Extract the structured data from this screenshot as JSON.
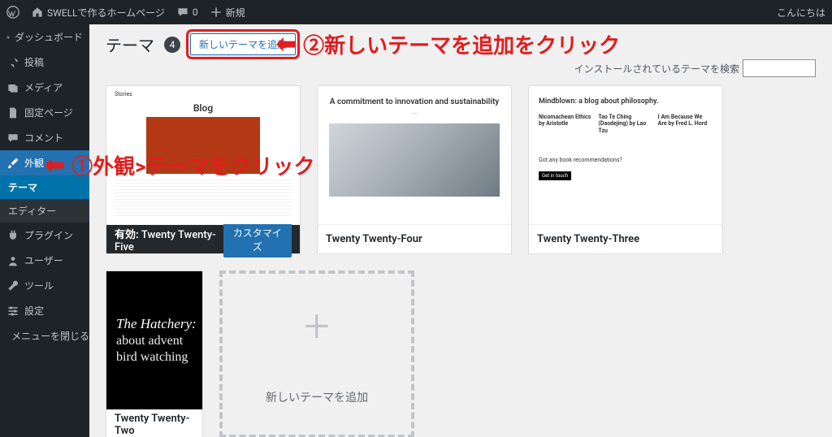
{
  "adminbar": {
    "site_name": "SWELLで作るホームページ",
    "comments": "0",
    "new": "新規",
    "greeting": "こんにちは"
  },
  "sidebar": {
    "dashboard": "ダッシュボード",
    "posts": "投稿",
    "media": "メディア",
    "pages": "固定ページ",
    "comments": "コメント",
    "appearance": "外観",
    "appearance_sub": {
      "themes": "テーマ",
      "editor": "エディター"
    },
    "plugins": "プラグイン",
    "users": "ユーザー",
    "tools": "ツール",
    "settings": "設定",
    "collapse": "メニューを閉じる"
  },
  "page": {
    "title": "テーマ",
    "count": "4",
    "add_new": "新しいテーマを追加",
    "search_label": "インストールされているテーマを検索",
    "active_prefix": "有効:"
  },
  "themes": [
    {
      "name": "Twenty Twenty-Five",
      "active": true,
      "customize": "カスタマイズ",
      "mock": {
        "blog_label": "Blog",
        "stories": "Stories"
      }
    },
    {
      "name": "Twenty Twenty-Four",
      "mock": {
        "head": "A commitment to innovation and sustainability"
      }
    },
    {
      "name": "Twenty Twenty-Three",
      "mock": {
        "tagline": "Mindblown: a blog about philosophy.",
        "col1_title": "Nicomachean Ethics by Aristotle",
        "col2_title": "Tao Te Ching (Daodejing) by Lao Tzu",
        "col3_title": "I Am Because We Are by Fred L. Hord",
        "cta_q": "Got any book recommendations?",
        "cta_btn": "Get in touch"
      }
    },
    {
      "name": "Twenty Twenty-Two",
      "mock": {
        "line1": "The Hatchery:",
        "line2": "about advent",
        "line3": "bird watching"
      }
    }
  ],
  "add_card": {
    "label": "新しいテーマを追加"
  },
  "annotations": {
    "a1": "①外観>テーマをクリック",
    "a2": "②新しいテーマを追加をクリック"
  }
}
